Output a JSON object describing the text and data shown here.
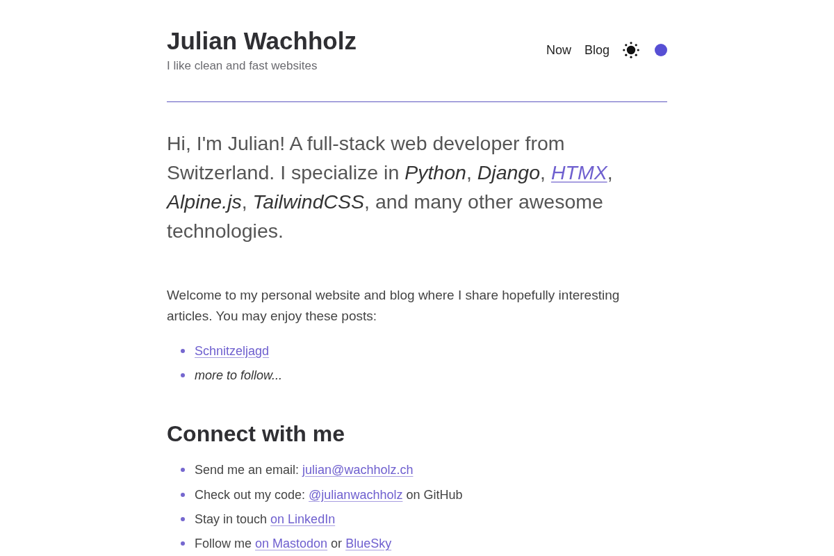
{
  "header": {
    "title": "Julian Wachholz",
    "tagline": "I like clean and fast websites",
    "nav": [
      {
        "label": "Now"
      },
      {
        "label": "Blog"
      }
    ]
  },
  "intro": [
    {
      "kind": "text",
      "text": "Hi, I'm Julian! A full-stack web developer from Switzerland. I specialize in "
    },
    {
      "kind": "em",
      "text": "Python"
    },
    {
      "kind": "text",
      "text": ", "
    },
    {
      "kind": "em",
      "text": "Django"
    },
    {
      "kind": "text",
      "text": ", "
    },
    {
      "kind": "em_link",
      "text": "HTMX"
    },
    {
      "kind": "text",
      "text": ", "
    },
    {
      "kind": "em",
      "text": "Alpine.js"
    },
    {
      "kind": "text",
      "text": ", "
    },
    {
      "kind": "em",
      "text": "TailwindCSS"
    },
    {
      "kind": "text",
      "text": ", and many other awesome technologies."
    }
  ],
  "welcome": "Welcome to my personal website and blog where I share hopefully interesting articles. You may enjoy these posts:",
  "posts": [
    {
      "kind": "link",
      "text": "Schnitzeljagd"
    },
    {
      "kind": "em",
      "text": "more to follow..."
    }
  ],
  "connect": {
    "heading": "Connect with me",
    "items": [
      [
        {
          "kind": "text",
          "text": "Send me an email: "
        },
        {
          "kind": "link",
          "text": "julian@wachholz.ch"
        }
      ],
      [
        {
          "kind": "text",
          "text": "Check out my code: "
        },
        {
          "kind": "link",
          "text": "@julianwachholz"
        },
        {
          "kind": "text",
          "text": " on GitHub"
        }
      ],
      [
        {
          "kind": "text",
          "text": "Stay in touch "
        },
        {
          "kind": "link",
          "text": "on LinkedIn"
        }
      ],
      [
        {
          "kind": "text",
          "text": "Follow me "
        },
        {
          "kind": "link",
          "text": "on Mastodon"
        },
        {
          "kind": "text",
          "text": " or "
        },
        {
          "kind": "link",
          "text": "BlueSky"
        }
      ]
    ]
  }
}
